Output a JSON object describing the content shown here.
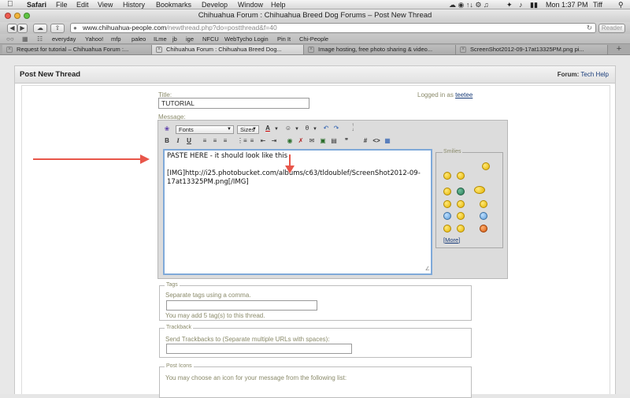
{
  "menubar": {
    "apple": "",
    "app": "Safari",
    "items": [
      "File",
      "Edit",
      "View",
      "History",
      "Bookmarks",
      "Develop",
      "Window",
      "Help"
    ],
    "clock": "Mon 1:37 PM",
    "user": "Tiff"
  },
  "window": {
    "title": "Chihuahua Forum : Chihuahua Breed Dog Forums – Post New Thread"
  },
  "toolbar": {
    "url_domain": "www.chihuahua-people.com",
    "url_path": "/newthread.php?do=postthread&f=40",
    "reader": "Reader"
  },
  "bookmarks": [
    "everyday",
    "Yahoo!",
    "mfp",
    "paleo",
    "ILme",
    "jb",
    "ige",
    "NFCU",
    "WebTycho Login",
    "Pin It",
    "Chi-People"
  ],
  "tabs": [
    "Request for tutorial – Chihuahua Forum :...",
    "Chihuahua Forum : Chihuahua Breed Dog...",
    "Image hosting, free photo sharing & video...",
    "ScreenShot2012-09-17at13325PM.png pi..."
  ],
  "panel": {
    "title": "Post New Thread",
    "forum_label": "Forum:",
    "forum_value": "Tech Help"
  },
  "form": {
    "title_label": "Title:",
    "title_value": "TUTORIAL",
    "logged_in_prefix": "Logged in as",
    "logged_in_user": "teetee",
    "message_label": "Message:"
  },
  "editor": {
    "font_select": "Fonts",
    "size_select": "Sizes",
    "bold": "B",
    "italic": "I",
    "underline": "U",
    "textarea_lines": [
      "PASTE HERE - it should look like this",
      "",
      "[IMG]http://i25.photobucket.com/albums/c63/tldoublef/ScreenShot2012-09-",
      "17at13325PM.png[/IMG]"
    ],
    "smilies_legend": "Smilies",
    "more_link": "More"
  },
  "tags": {
    "legend": "Tags",
    "hint": "Separate tags using a comma.",
    "note": "You may add 5 tag(s) to this thread."
  },
  "trackback": {
    "legend": "Trackback",
    "hint": "Send Trackbacks to (Separate multiple URLs with spaces):"
  },
  "post_icons": {
    "legend": "Post Icons",
    "hint": "You may choose an icon for your message from the following list:"
  },
  "colors": {
    "arrow": "#e8564a",
    "link": "#1a3d7a",
    "label": "#8a8a6a",
    "focus": "#7fa9d9"
  }
}
